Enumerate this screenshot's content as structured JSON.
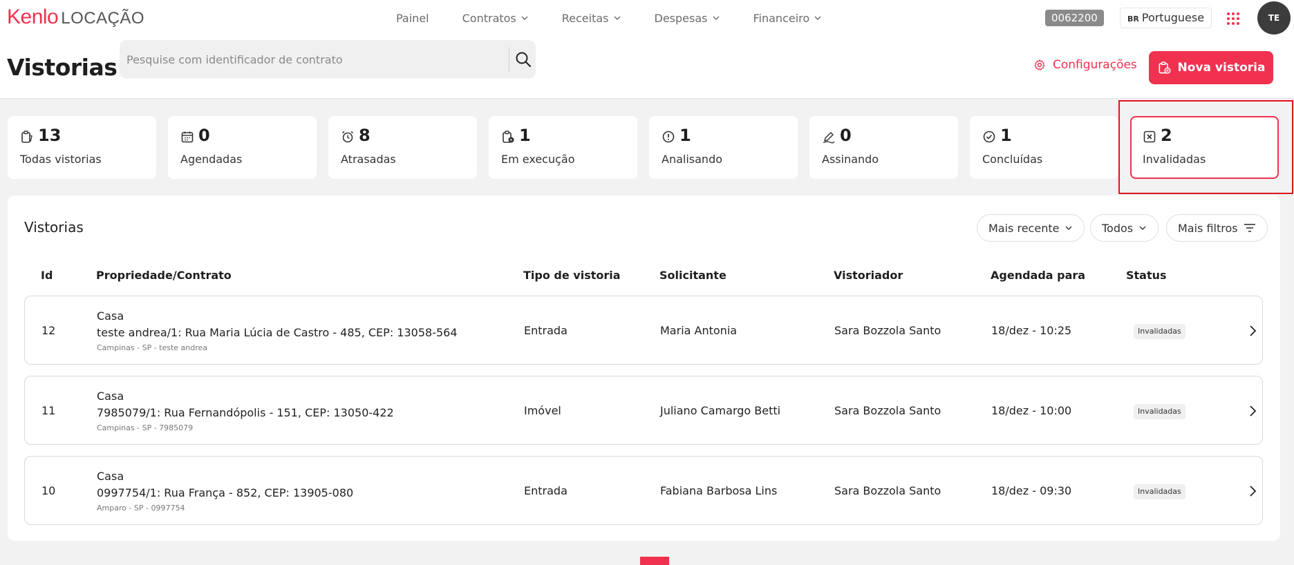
{
  "brand": {
    "logo_main": "Kenlo",
    "logo_sub": "LOCAÇÃO",
    "accent": "#f0314f"
  },
  "nav": [
    {
      "label": "Painel",
      "dropdown": false
    },
    {
      "label": "Contratos",
      "dropdown": true
    },
    {
      "label": "Receitas",
      "dropdown": true
    },
    {
      "label": "Despesas",
      "dropdown": true
    },
    {
      "label": "Financeiro",
      "dropdown": true
    }
  ],
  "header": {
    "account_code": "0062200",
    "language_flag": "BR",
    "language": "Portuguese",
    "avatar_initials": "TE"
  },
  "page": {
    "title": "Vistorias"
  },
  "search": {
    "placeholder": "Pesquise com identificador de contrato",
    "value": ""
  },
  "actions": {
    "config_label": "Configurações",
    "new_label": "Nova vistoria"
  },
  "stats": [
    {
      "value": "13",
      "label": "Todas vistorias",
      "icon": "clipboard-icon",
      "active": false
    },
    {
      "value": "0",
      "label": "Agendadas",
      "icon": "calendar-icon",
      "active": false
    },
    {
      "value": "8",
      "label": "Atrasadas",
      "icon": "alarm-clock-icon",
      "active": false
    },
    {
      "value": "1",
      "label": "Em execução",
      "icon": "clipboard-play-icon",
      "active": false
    },
    {
      "value": "1",
      "label": "Analisando",
      "icon": "alert-circle-icon",
      "active": false
    },
    {
      "value": "0",
      "label": "Assinando",
      "icon": "pen-icon",
      "active": false
    },
    {
      "value": "1",
      "label": "Concluídas",
      "icon": "check-circle-icon",
      "active": false
    },
    {
      "value": "2",
      "label": "Invalidadas",
      "icon": "x-square-icon",
      "active": true
    }
  ],
  "list": {
    "title": "Vistorias",
    "filters": {
      "sort": "Mais recente",
      "scope": "Todos",
      "more": "Mais filtros"
    },
    "columns": [
      "Id",
      "Propriedade/Contrato",
      "Tipo de vistoria",
      "Solicitante",
      "Vistoriador",
      "Agendada para",
      "Status"
    ],
    "rows": [
      {
        "id": "12",
        "property_type": "Casa",
        "address": "teste andrea/1: Rua Maria Lúcia de Castro - 485, CEP: 13058-564",
        "location": "Campinas - SP - teste andrea",
        "tipo": "Entrada",
        "solicitante": "Maria Antonia",
        "vistoriador": "Sara Bozzola Santo",
        "agendada": "18/dez - 10:25",
        "status": "Invalidadas"
      },
      {
        "id": "11",
        "property_type": "Casa",
        "address": "7985079/1: Rua Fernandópolis - 151, CEP: 13050-422",
        "location": "Campinas - SP - 7985079",
        "tipo": "Imóvel",
        "solicitante": "Juliano Camargo Betti",
        "vistoriador": "Sara Bozzola Santo",
        "agendada": "18/dez - 10:00",
        "status": "Invalidadas"
      },
      {
        "id": "10",
        "property_type": "Casa",
        "address": "0997754/1: Rua França - 852, CEP: 13905-080",
        "location": "Amparo - SP - 0997754",
        "tipo": "Entrada",
        "solicitante": "Fabiana Barbosa Lins",
        "vistoriador": "Sara Bozzola Santo",
        "agendada": "18/dez - 09:30",
        "status": "Invalidadas"
      }
    ]
  }
}
